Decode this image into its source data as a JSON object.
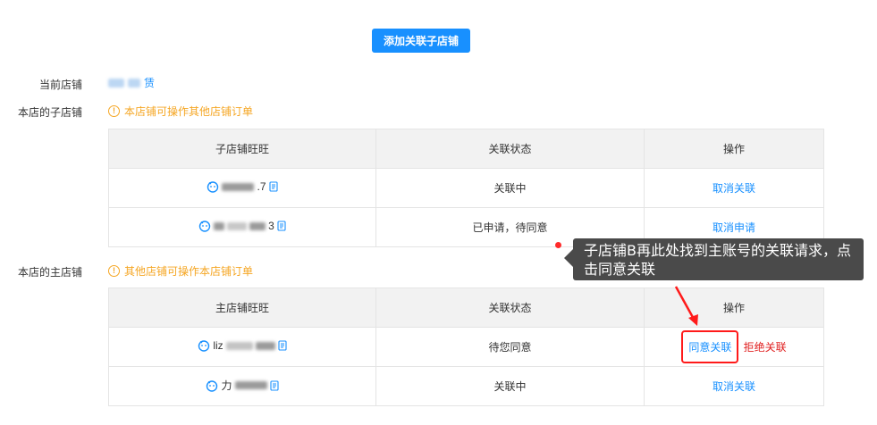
{
  "toolbar": {
    "add_label": "添加关联子店铺"
  },
  "current_shop": {
    "label": "当前店铺",
    "name_tail": "赁"
  },
  "sub_section": {
    "label": "本店的子店铺",
    "tip": "本店铺可操作其他店铺订单",
    "headers": [
      "子店铺旺旺",
      "关联状态",
      "操作"
    ],
    "rows": [
      {
        "name_tail": ".7",
        "status": "关联中",
        "action": "取消关联"
      },
      {
        "name_tail": "3",
        "status": "已申请，待同意",
        "action": "取消申请"
      }
    ]
  },
  "main_section": {
    "label": "本店的主店铺",
    "tip": "其他店铺可操作本店铺订单",
    "headers": [
      "主店铺旺旺",
      "关联状态",
      "操作"
    ],
    "rows": [
      {
        "name_head": "liz",
        "status": "待您同意",
        "action_agree": "同意关联",
        "action_reject": "拒绝关联"
      },
      {
        "name_head": "力",
        "status": "关联中",
        "action": "取消关联"
      }
    ]
  },
  "annotation": {
    "text": "子店铺B再此处找到主账号的关联请求，点击同意关联"
  },
  "colors": {
    "primary": "#1890ff",
    "warning": "#f5a623",
    "danger": "#e02020",
    "tooltip_bg": "#4a4a4a"
  }
}
